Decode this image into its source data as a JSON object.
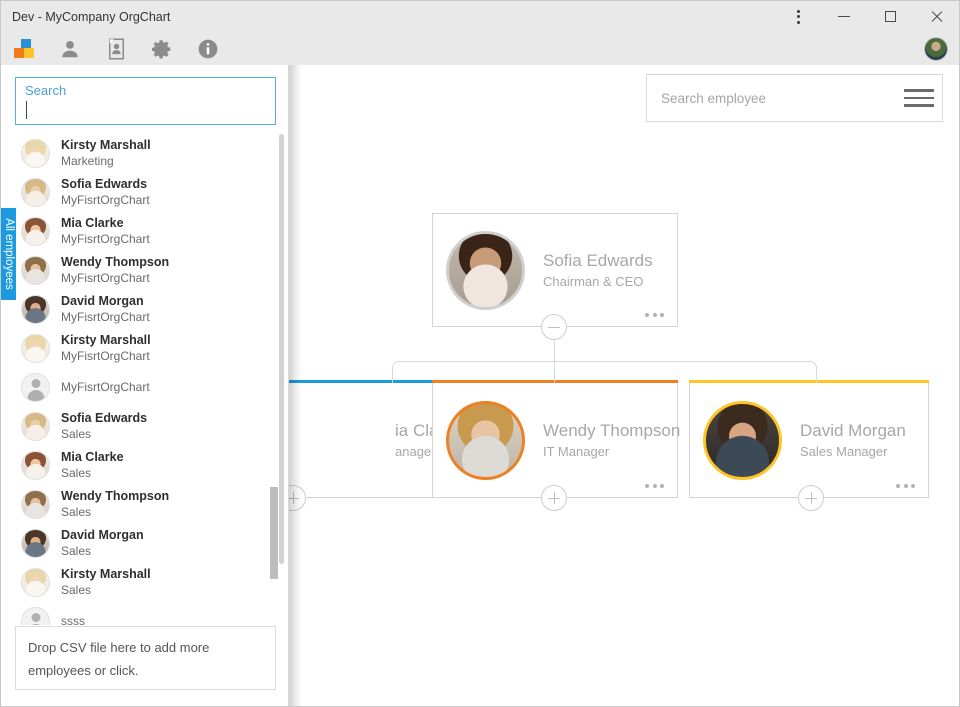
{
  "window": {
    "title": "Dev - MyCompany OrgChart",
    "controls": {
      "menu": "⋮",
      "minimize": "–",
      "maximize": "□",
      "close": "✕"
    }
  },
  "toolbar": {
    "items": [
      {
        "name": "app-logo-icon",
        "label": "OrgChart"
      },
      {
        "name": "person-icon",
        "label": "Employees"
      },
      {
        "name": "document-icon",
        "label": "Report"
      },
      {
        "name": "gear-icon",
        "label": "Settings"
      },
      {
        "name": "info-icon",
        "label": "About"
      }
    ],
    "account_label": "Account"
  },
  "left_panel": {
    "search": {
      "label": "Search",
      "value": "",
      "placeholder": ""
    },
    "vertical_tab": "All employees",
    "employees": [
      {
        "name": "Kirsty Marshall",
        "dept": "Marketing",
        "avatar": "a-kirsty"
      },
      {
        "name": "Sofia Edwards",
        "dept": "MyFisrtOrgChart",
        "avatar": "a-sofia"
      },
      {
        "name": "Mia Clarke",
        "dept": "MyFisrtOrgChart",
        "avatar": "a-mia"
      },
      {
        "name": "Wendy Thompson",
        "dept": "MyFisrtOrgChart",
        "avatar": "a-wendy"
      },
      {
        "name": "David Morgan",
        "dept": "MyFisrtOrgChart",
        "avatar": "a-david"
      },
      {
        "name": "Kirsty Marshall",
        "dept": "MyFisrtOrgChart",
        "avatar": "a-kirsty"
      },
      {
        "name": "",
        "dept": "MyFisrtOrgChart",
        "avatar": "a-blank"
      },
      {
        "name": "Sofia Edwards",
        "dept": "Sales",
        "avatar": "a-sofia"
      },
      {
        "name": "Mia Clarke",
        "dept": "Sales",
        "avatar": "a-mia"
      },
      {
        "name": "Wendy Thompson",
        "dept": "Sales",
        "avatar": "a-wendy"
      },
      {
        "name": "David Morgan",
        "dept": "Sales",
        "avatar": "a-david"
      },
      {
        "name": "Kirsty Marshall",
        "dept": "Sales",
        "avatar": "a-kirsty"
      },
      {
        "name": "",
        "dept": "ssss",
        "avatar": "a-blank"
      }
    ],
    "dropzone": "Drop CSV file here to add more employees or click."
  },
  "canvas": {
    "search_employee": {
      "value": "",
      "placeholder": "Search employee"
    },
    "menu_label": "Menu"
  },
  "org_chart": {
    "nodes": [
      {
        "id": "root",
        "name": "Sofia Edwards",
        "title": "Chairman & CEO",
        "accent": "",
        "photo": "p-sofia",
        "toggle": "collapse"
      },
      {
        "id": "c1",
        "name": "ia Clarke",
        "title": "anager",
        "accent": "#1b9ae0",
        "photo": "p-mia",
        "toggle": "expand"
      },
      {
        "id": "c2",
        "name": "Wendy Thompson",
        "title": "IT Manager",
        "accent": "#ed8022",
        "photo": "p-wendy",
        "toggle": "expand"
      },
      {
        "id": "c3",
        "name": "David Morgan",
        "title": "Sales Manager",
        "accent": "#ffc425",
        "photo": "p-david",
        "toggle": "expand"
      }
    ]
  },
  "colors": {
    "accent_blue": "#1b9ae0",
    "accent_orange": "#ed8022",
    "accent_yellow": "#ffc425",
    "chrome": "#e9e9e9",
    "line": "#d8d8d8"
  }
}
